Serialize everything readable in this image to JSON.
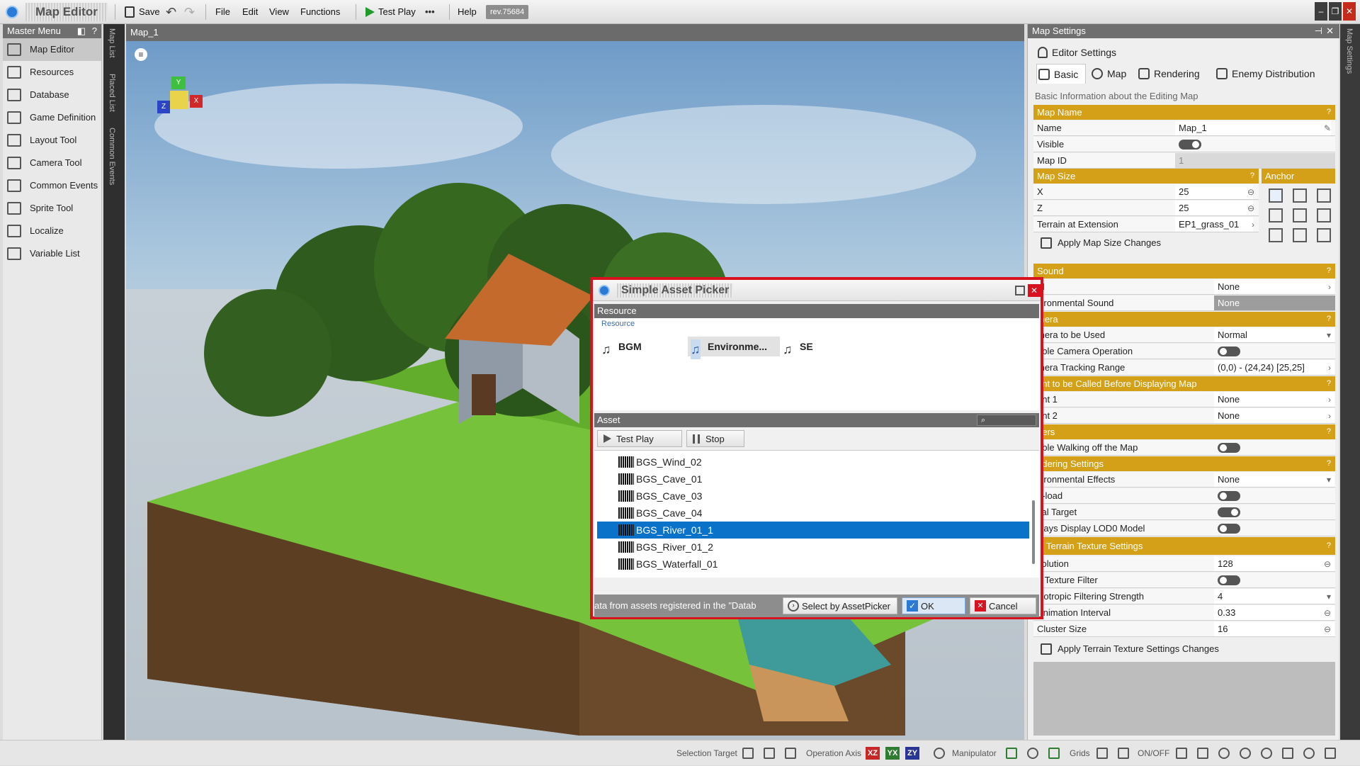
{
  "app": {
    "name": "Map Editor",
    "revision": "rev.75684"
  },
  "toolbar": {
    "save": "Save",
    "menus": [
      "File",
      "Edit",
      "View",
      "Functions"
    ],
    "test_play": "Test Play",
    "more": "•••",
    "help": "Help"
  },
  "master_menu": {
    "title": "Master Menu",
    "items": [
      "Map Editor",
      "Resources",
      "Database",
      "Game Definition",
      "Layout Tool",
      "Camera Tool",
      "Common Events",
      "Sprite Tool",
      "Localize",
      "Variable List"
    ]
  },
  "side_tabs": [
    "Map List",
    "Placed List",
    "Common Events"
  ],
  "viewport": {
    "title": "Map_1",
    "gizmo": {
      "y": "Y",
      "z": "Z",
      "x": "X"
    }
  },
  "settings": {
    "title": "Map Settings",
    "side_label": "Map Settings",
    "editor_settings": "Editor Settings",
    "tabs": [
      "Basic",
      "Map",
      "Rendering",
      "Enemy Distribution"
    ],
    "description": "Basic Information about the Editing Map",
    "map_name": {
      "header": "Map Name",
      "name_label": "Name",
      "name_value": "Map_1",
      "visible_label": "Visible",
      "id_label": "Map ID",
      "id_value": "1"
    },
    "map_size": {
      "header": "Map Size",
      "anchor": "Anchor",
      "x_label": "X",
      "x_value": "25",
      "z_label": "Z",
      "z_value": "25",
      "terrain_label": "Terrain at Extension",
      "terrain_value": "EP1_grass_01",
      "apply": "Apply Map Size Changes"
    },
    "sound": {
      "header": "Sound",
      "bgm_label": "M",
      "bgm_value": "None",
      "env_label": "vironmental Sound",
      "env_value": "None"
    },
    "camera": {
      "header": "mera",
      "used_label": "mera to be Used",
      "used_value": "Normal",
      "op_label": "able Camera Operation",
      "range_label": "mera Tracking Range",
      "range_value": "(0,0) - (24,24) [25,25]"
    },
    "event": {
      "header": "ent to be Called Before Displaying Map",
      "e1_label": "ent 1",
      "e1_value": "None",
      "e2_label": "ent 2",
      "e2_value": "None"
    },
    "others": {
      "header": "hers",
      "walk_label": "able Walking off the Map"
    },
    "rendering": {
      "header": "ndering Settings",
      "env_fx_label": "vironmental Effects",
      "env_fx_value": "None",
      "preload_label": "e-load",
      "focal_label": "cal Target",
      "lod_label": "ways Display LOD0 Model"
    },
    "terrain": {
      "header": "Terrain Texture Settings",
      "res_label": "solution",
      "res_value": "128",
      "filter_label": "e Texture Filter",
      "aniso_label": "isotropic Filtering Strength",
      "aniso_value": "4",
      "anim_label": "Animation Interval",
      "anim_value": "0.33",
      "cluster_label": "Cluster Size",
      "cluster_value": "16",
      "apply": "Apply Terrain Texture Settings Changes"
    }
  },
  "dialog": {
    "title": "Simple Asset Picker",
    "resource_header": "Resource",
    "resource_sub": "Resource",
    "resources": [
      "BGM",
      "Environme...",
      "SE"
    ],
    "asset_header": "Asset",
    "test_play": "Test Play",
    "stop": "Stop",
    "assets": [
      "BGS_Wind_02",
      "BGS_Cave_01",
      "BGS_Cave_03",
      "BGS_Cave_04",
      "BGS_River_01_1",
      "BGS_River_01_2",
      "BGS_Waterfall_01"
    ],
    "selected": "BGS_River_01_1",
    "footer_text": "ata from assets registered in the \"Datab",
    "select_by": "Select by AssetPicker",
    "ok": "OK",
    "cancel": "Cancel"
  },
  "status_bar": {
    "selection_target": "Selection Target",
    "operation_axis": "Operation Axis",
    "axes": [
      "XZ",
      "YX",
      "ZY"
    ],
    "manipulator": "Manipulator",
    "grids": "Grids",
    "onoff": "ON/OFF"
  },
  "colors": {
    "section": "#d4a017",
    "selected_row": "#0a72c9",
    "dialog_border": "#d8121e"
  }
}
